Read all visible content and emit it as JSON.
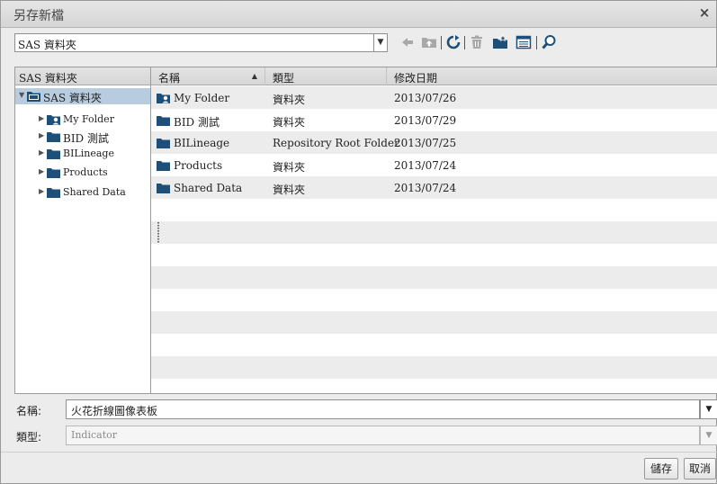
{
  "window": {
    "title": "另存新檔",
    "close_glyph": "×"
  },
  "path_bar": {
    "value": "SAS 資料夾",
    "dropdown_glyph": "▼"
  },
  "toolbar": {
    "icons": [
      "back-arrow-icon",
      "folder-up-icon",
      "refresh-icon",
      "delete-icon",
      "new-folder-icon",
      "view-details-icon",
      "search-icon"
    ]
  },
  "tree": {
    "header": "SAS 資料夾",
    "root": {
      "label": "SAS 資料夾",
      "expanded": true,
      "selected": true
    },
    "children": [
      {
        "label": "My Folder",
        "icon": "user-folder-icon"
      },
      {
        "label": "BID 測試",
        "icon": "folder-icon"
      },
      {
        "label": "BILineage",
        "icon": "folder-icon"
      },
      {
        "label": "Products",
        "icon": "folder-icon"
      },
      {
        "label": "Shared Data",
        "icon": "folder-icon"
      }
    ]
  },
  "file_list": {
    "columns": {
      "name": "名稱",
      "type": "類型",
      "modified": "修改日期"
    },
    "sort_glyph": "▲",
    "rows": [
      {
        "name": "My Folder",
        "type": "資料夾",
        "modified": "2013/07/26",
        "icon": "user-folder-icon"
      },
      {
        "name": "BID 測試",
        "type": "資料夾",
        "modified": "2013/07/29",
        "icon": "folder-icon"
      },
      {
        "name": "BILineage",
        "type": "Repository Root Folder",
        "modified": "2013/07/25",
        "icon": "folder-icon"
      },
      {
        "name": "Products",
        "type": "資料夾",
        "modified": "2013/07/24",
        "icon": "folder-icon"
      },
      {
        "name": "Shared Data",
        "type": "資料夾",
        "modified": "2013/07/24",
        "icon": "folder-icon"
      }
    ]
  },
  "form": {
    "name_label": "名稱:",
    "name_value": "火花折線圖像表板",
    "type_label": "類型:",
    "type_value": "Indicator",
    "dropdown_glyph": "▼"
  },
  "buttons": {
    "save": "儲存",
    "cancel": "取消"
  },
  "colors": {
    "selection": "#b8cce0",
    "folder": "#1d4f78",
    "alt_row": "#ececec"
  }
}
